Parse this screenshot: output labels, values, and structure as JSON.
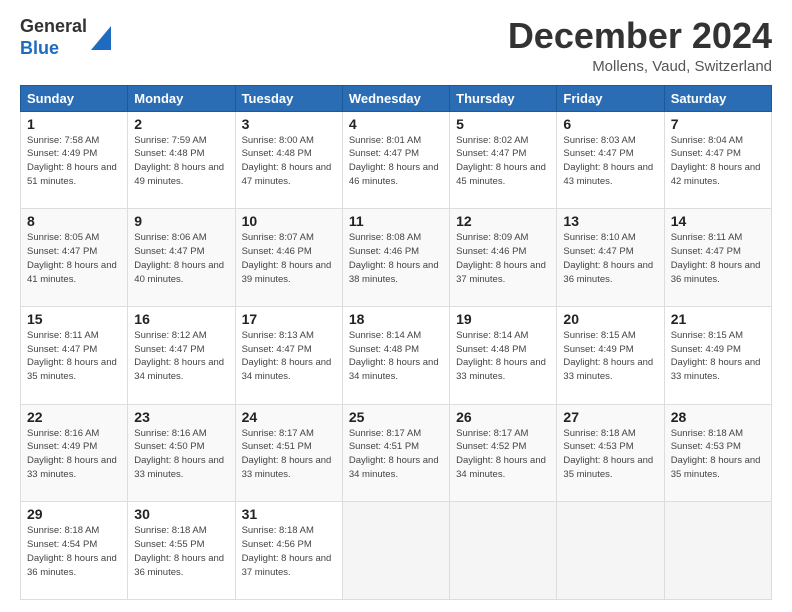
{
  "header": {
    "logo": {
      "general": "General",
      "blue": "Blue"
    },
    "title": "December 2024",
    "location": "Mollens, Vaud, Switzerland"
  },
  "calendar": {
    "days_of_week": [
      "Sunday",
      "Monday",
      "Tuesday",
      "Wednesday",
      "Thursday",
      "Friday",
      "Saturday"
    ],
    "weeks": [
      [
        {
          "day": 1,
          "sunrise": "7:58 AM",
          "sunset": "4:49 PM",
          "daylight": "8 hours and 51 minutes."
        },
        {
          "day": 2,
          "sunrise": "7:59 AM",
          "sunset": "4:48 PM",
          "daylight": "8 hours and 49 minutes."
        },
        {
          "day": 3,
          "sunrise": "8:00 AM",
          "sunset": "4:48 PM",
          "daylight": "8 hours and 47 minutes."
        },
        {
          "day": 4,
          "sunrise": "8:01 AM",
          "sunset": "4:47 PM",
          "daylight": "8 hours and 46 minutes."
        },
        {
          "day": 5,
          "sunrise": "8:02 AM",
          "sunset": "4:47 PM",
          "daylight": "8 hours and 45 minutes."
        },
        {
          "day": 6,
          "sunrise": "8:03 AM",
          "sunset": "4:47 PM",
          "daylight": "8 hours and 43 minutes."
        },
        {
          "day": 7,
          "sunrise": "8:04 AM",
          "sunset": "4:47 PM",
          "daylight": "8 hours and 42 minutes."
        }
      ],
      [
        {
          "day": 8,
          "sunrise": "8:05 AM",
          "sunset": "4:47 PM",
          "daylight": "8 hours and 41 minutes."
        },
        {
          "day": 9,
          "sunrise": "8:06 AM",
          "sunset": "4:47 PM",
          "daylight": "8 hours and 40 minutes."
        },
        {
          "day": 10,
          "sunrise": "8:07 AM",
          "sunset": "4:46 PM",
          "daylight": "8 hours and 39 minutes."
        },
        {
          "day": 11,
          "sunrise": "8:08 AM",
          "sunset": "4:46 PM",
          "daylight": "8 hours and 38 minutes."
        },
        {
          "day": 12,
          "sunrise": "8:09 AM",
          "sunset": "4:46 PM",
          "daylight": "8 hours and 37 minutes."
        },
        {
          "day": 13,
          "sunrise": "8:10 AM",
          "sunset": "4:47 PM",
          "daylight": "8 hours and 36 minutes."
        },
        {
          "day": 14,
          "sunrise": "8:11 AM",
          "sunset": "4:47 PM",
          "daylight": "8 hours and 36 minutes."
        }
      ],
      [
        {
          "day": 15,
          "sunrise": "8:11 AM",
          "sunset": "4:47 PM",
          "daylight": "8 hours and 35 minutes."
        },
        {
          "day": 16,
          "sunrise": "8:12 AM",
          "sunset": "4:47 PM",
          "daylight": "8 hours and 34 minutes."
        },
        {
          "day": 17,
          "sunrise": "8:13 AM",
          "sunset": "4:47 PM",
          "daylight": "8 hours and 34 minutes."
        },
        {
          "day": 18,
          "sunrise": "8:14 AM",
          "sunset": "4:48 PM",
          "daylight": "8 hours and 34 minutes."
        },
        {
          "day": 19,
          "sunrise": "8:14 AM",
          "sunset": "4:48 PM",
          "daylight": "8 hours and 33 minutes."
        },
        {
          "day": 20,
          "sunrise": "8:15 AM",
          "sunset": "4:49 PM",
          "daylight": "8 hours and 33 minutes."
        },
        {
          "day": 21,
          "sunrise": "8:15 AM",
          "sunset": "4:49 PM",
          "daylight": "8 hours and 33 minutes."
        }
      ],
      [
        {
          "day": 22,
          "sunrise": "8:16 AM",
          "sunset": "4:49 PM",
          "daylight": "8 hours and 33 minutes."
        },
        {
          "day": 23,
          "sunrise": "8:16 AM",
          "sunset": "4:50 PM",
          "daylight": "8 hours and 33 minutes."
        },
        {
          "day": 24,
          "sunrise": "8:17 AM",
          "sunset": "4:51 PM",
          "daylight": "8 hours and 33 minutes."
        },
        {
          "day": 25,
          "sunrise": "8:17 AM",
          "sunset": "4:51 PM",
          "daylight": "8 hours and 34 minutes."
        },
        {
          "day": 26,
          "sunrise": "8:17 AM",
          "sunset": "4:52 PM",
          "daylight": "8 hours and 34 minutes."
        },
        {
          "day": 27,
          "sunrise": "8:18 AM",
          "sunset": "4:53 PM",
          "daylight": "8 hours and 35 minutes."
        },
        {
          "day": 28,
          "sunrise": "8:18 AM",
          "sunset": "4:53 PM",
          "daylight": "8 hours and 35 minutes."
        }
      ],
      [
        {
          "day": 29,
          "sunrise": "8:18 AM",
          "sunset": "4:54 PM",
          "daylight": "8 hours and 36 minutes."
        },
        {
          "day": 30,
          "sunrise": "8:18 AM",
          "sunset": "4:55 PM",
          "daylight": "8 hours and 36 minutes."
        },
        {
          "day": 31,
          "sunrise": "8:18 AM",
          "sunset": "4:56 PM",
          "daylight": "8 hours and 37 minutes."
        },
        null,
        null,
        null,
        null
      ]
    ]
  }
}
